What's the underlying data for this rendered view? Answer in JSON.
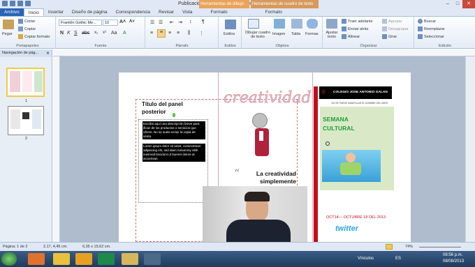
{
  "window": {
    "title": "Publicación2 - Microsoft Publisher",
    "ctx_tab_drawing": "Herramientas de dibujo",
    "ctx_tab_textbox": "Herramientas de cuadro de texto",
    "buttons": [
      "–",
      "□",
      "✕"
    ]
  },
  "tabs": [
    "Archivo",
    "Inicio",
    "Insertar",
    "Diseño de página",
    "Correspondencia",
    "Revisar",
    "Vista",
    "Formato",
    "Formato"
  ],
  "ribbon": {
    "clipboard": {
      "label": "Portapapeles",
      "paste": "Pegar",
      "cut": "Cortar",
      "copy": "Copiar",
      "copy_format": "Copiar formato"
    },
    "font": {
      "label": "Fuente",
      "family": "Franklin Gothic Me...",
      "size": "10"
    },
    "paragraph": {
      "label": "Párrafo"
    },
    "styles": {
      "label": "Estilos",
      "styles_btn": "Estilos"
    },
    "objects": {
      "label": "Objetos",
      "draw_textbox": "Dibujar cuadro de texto",
      "image": "Imagen",
      "table": "Tabla",
      "shapes": "Formas"
    },
    "arrange": {
      "label": "Organizar",
      "wrap": "Ajustar texto",
      "bring_forward": "Traer adelante",
      "send_back": "Enviar atrás",
      "align": "Alinear",
      "group": "Agrupar",
      "ungroup": "Desagrupar",
      "rotate": "Girar"
    },
    "edit": {
      "label": "Edición",
      "find": "Buscar",
      "replace": "Reemplazar",
      "select": "Seleccionar"
    }
  },
  "nav": {
    "title": "Navegación de pág...",
    "pages": [
      "1",
      "2"
    ]
  },
  "document": {
    "panel_title": "Título del panel posterior",
    "body_text_1": "Escriba aquí una descripción breve para ificaz de los productos o servicios que ofrece. No se suele incluir la copia de venta.",
    "body_text_2": "Lorem ipsum dolor sit amet, consectetuer adipiscing elit, sed diam nonummy nibh euismod tincidunt ut laoreet dolore al accumsan.",
    "headline": "creatividad",
    "quote": "La creatividad simplemente consiste en conectar ideas",
    "quote_open": "“",
    "quote_close": "”",
    "school": "COLEGIO JOSE ANTONIO GALAN",
    "subtitle": "NO SE PUEDE MANIPULAR EL NOMBRE DEL LIBRO",
    "event_title": "SEMANA CULTURAL",
    "dates": "OCT14— OCTUBRE 18 DEL 2013",
    "twitter": "twitter"
  },
  "status": {
    "page": "Página: 1 de 2",
    "position": "2,17, 4,45 cm.",
    "size": "6,35 x 15,62 cm.",
    "zoom": "74%"
  },
  "taskbar": {
    "links": "Vínculos",
    "lang": "ES",
    "time": "08:56 p.m.",
    "date": "08/08/2013"
  }
}
